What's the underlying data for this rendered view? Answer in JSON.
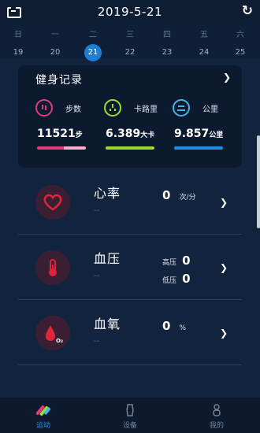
{
  "header": {
    "title": "2019-5-21"
  },
  "week": {
    "days": [
      {
        "name": "日",
        "num": "19"
      },
      {
        "name": "一",
        "num": "20"
      },
      {
        "name": "二",
        "num": "21",
        "selected": true
      },
      {
        "name": "三",
        "num": "22"
      },
      {
        "name": "四",
        "num": "23"
      },
      {
        "name": "五",
        "num": "24"
      },
      {
        "name": "六",
        "num": "25"
      }
    ]
  },
  "fitness": {
    "title": "健身记录",
    "stats": [
      {
        "label": "步数",
        "value": "11521",
        "unit": "步",
        "color": "#e23a7a",
        "bar_color": "#e23a7a"
      },
      {
        "label": "卡路里",
        "value": "6.389",
        "unit": "大卡",
        "color": "#9bdc2d",
        "bar_color": "#9bdc2d"
      },
      {
        "label": "公里",
        "value": "9.857",
        "unit": "公里",
        "color": "#3fb6e6",
        "bar_color": "#1f8fe0"
      }
    ]
  },
  "health": {
    "heart": {
      "name": "心率",
      "sub": "--",
      "value": "0",
      "unit": "次/分"
    },
    "blood_pressure": {
      "name": "血压",
      "sub": "--",
      "high_label": "高压",
      "high_value": "0",
      "low_label": "低压",
      "low_value": "0"
    },
    "oxygen": {
      "name": "血氧",
      "sub": "--",
      "value": "0",
      "unit": "%",
      "icon_text": "O₂"
    }
  },
  "tabs": [
    {
      "label": "运动",
      "active": true
    },
    {
      "label": "设备"
    },
    {
      "label": "我的"
    }
  ],
  "colors": {
    "accent": "#1b7fd8",
    "background": "#12243d",
    "icon_red": "#e0253a"
  }
}
